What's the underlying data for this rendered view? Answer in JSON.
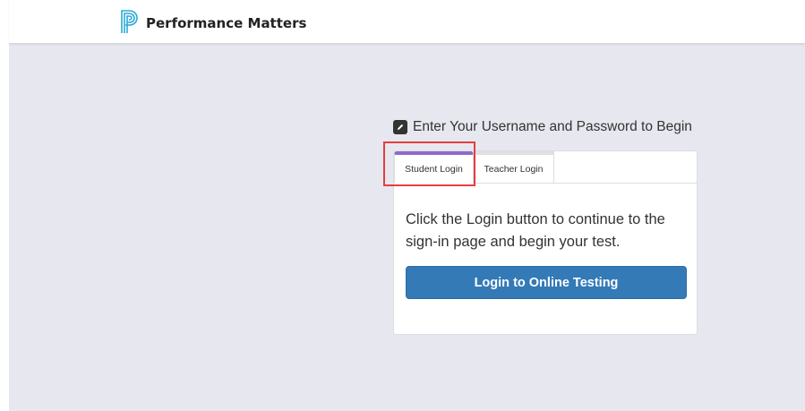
{
  "header": {
    "brand": "Performance Matters",
    "logo_icon": "performance-matters-logo-icon"
  },
  "login": {
    "prompt": "Enter Your Username and Password to Begin",
    "prompt_icon": "edit-icon",
    "tabs": [
      {
        "label": "Student Login",
        "active": true
      },
      {
        "label": "Teacher Login",
        "active": false
      }
    ],
    "message": "Click the Login button to continue to the sign-in page and begin your test.",
    "button_label": "Login to Online Testing"
  },
  "colors": {
    "background": "#e7e7ef",
    "button": "#337ab7",
    "active_tab_accent": "#8e6bc9",
    "highlight": "#e53e3e"
  }
}
